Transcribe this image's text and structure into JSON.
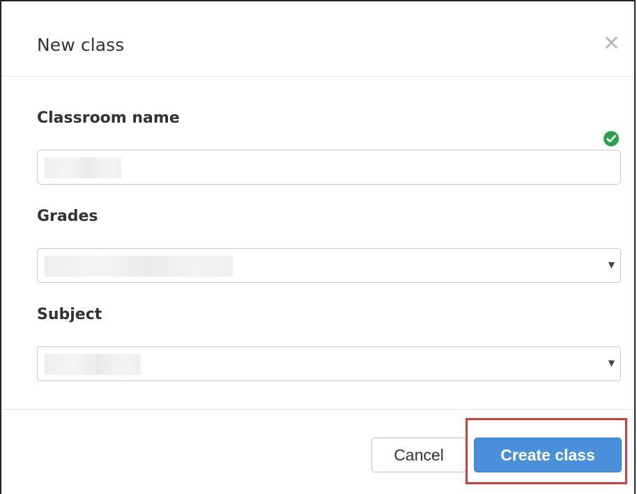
{
  "dialog": {
    "title": "New class",
    "close_icon": "close-icon"
  },
  "form": {
    "classroom_name": {
      "label": "Classroom name",
      "value": "",
      "status_icon": "check-circle-icon",
      "status_color": "#2e9f4a"
    },
    "grades": {
      "label": "Grades",
      "selected": ""
    },
    "subject": {
      "label": "Subject",
      "selected": ""
    }
  },
  "footer": {
    "cancel_label": "Cancel",
    "create_label": "Create class",
    "create_color": "#4a8fd9",
    "highlight_color": "#d43c3c"
  }
}
